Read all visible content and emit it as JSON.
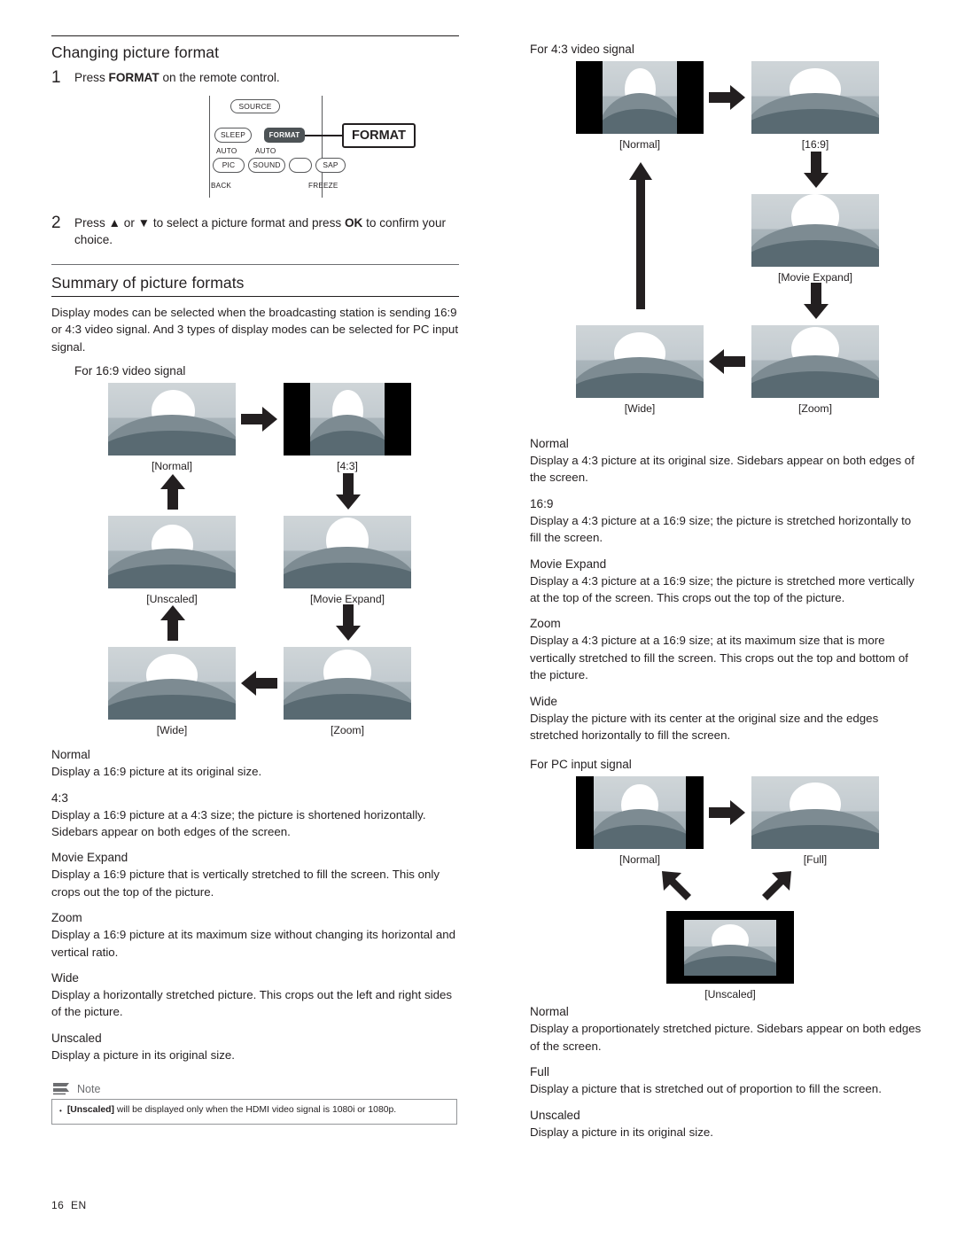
{
  "page": {
    "footer_page": "16",
    "footer_lang": "EN"
  },
  "left": {
    "heading": "Changing picture format",
    "step1": {
      "num": "1",
      "text_before": "Press ",
      "bold": "FORMAT",
      "text_after": " on the remote control."
    },
    "remote": {
      "source": "SOURCE",
      "sleep": "SLEEP",
      "format": "FORMAT",
      "auto_pic_top": "AUTO",
      "auto_pic": "PIC",
      "auto_sound_top": "AUTO",
      "auto_sound": "SOUND",
      "sap": "SAP",
      "back": "BACK",
      "freeze": "FREEZE",
      "callout": "FORMAT"
    },
    "step2": {
      "num": "2",
      "text": "Press ▲ or ▼ to select a picture format and press OK to confirm your choice.",
      "part1": "Press ",
      "part2": " or ",
      "part3": " to select a picture format and press ",
      "ok": "OK",
      "part4": " to confirm your choice."
    },
    "summary_heading": "Summary of picture formats",
    "summary_body": "Display modes can be selected when the broadcasting station is sending 16:9 or 4:3 video signal. And 3 types of display modes can be selected for PC input signal.",
    "diagram_title": "For 16:9 video signal",
    "diagram_captions": {
      "normal": "[Normal]",
      "four_three": "[4:3]",
      "unscaled": "[Unscaled]",
      "movie_expand": "[Movie Expand]",
      "wide": "[Wide]",
      "zoom": "[Zoom]"
    },
    "terms": [
      {
        "name": "Normal",
        "desc": "Display a 16:9 picture at its original size."
      },
      {
        "name": "4:3",
        "desc": "Display a 16:9 picture at a 4:3 size; the picture is shortened horizontally. Sidebars appear on both edges of the screen."
      },
      {
        "name": "Movie Expand",
        "desc": "Display a 16:9 picture that is vertically stretched to fill the screen. This only crops out the top of the picture."
      },
      {
        "name": "Zoom",
        "desc": "Display a 16:9 picture at its maximum size without changing its horizontal and vertical ratio."
      },
      {
        "name": "Wide",
        "desc": "Display a horizontally stretched picture. This crops out the left and right sides of the picture."
      },
      {
        "name": "Unscaled",
        "desc": "Display a picture in its original size."
      }
    ],
    "note": {
      "title": "Note",
      "bullet": "•",
      "text_bold": "[Unscaled]",
      "text_rest": " will be displayed only when the HDMI video signal is 1080i or 1080p."
    }
  },
  "right": {
    "diagram_title": "For 4:3 video signal",
    "diagram_captions": {
      "normal": "[Normal]",
      "sixteen_nine": "[16:9]",
      "movie_expand": "[Movie Expand]",
      "wide": "[Wide]",
      "zoom": "[Zoom]"
    },
    "terms": [
      {
        "name": "Normal",
        "desc": "Display a 4:3 picture at its original size. Sidebars appear on both edges of the screen."
      },
      {
        "name": "16:9",
        "desc": "Display a 4:3 picture at a 16:9 size; the picture is stretched horizontally to fill the screen."
      },
      {
        "name": "Movie Expand",
        "desc": "Display a 4:3 picture at a 16:9 size; the picture is stretched more vertically at the top of the screen. This crops out the top of the picture."
      },
      {
        "name": "Zoom",
        "desc": "Display a 4:3 picture at a 16:9 size; at its maximum size that is more vertically stretched to fill the screen. This crops out the top and bottom of the picture."
      },
      {
        "name": "Wide",
        "desc": "Display the picture with its center at the original size and the edges stretched horizontally to fill the screen."
      }
    ],
    "pc_title": "For PC input signal",
    "pc_captions": {
      "normal": "[Normal]",
      "full": "[Full]",
      "unscaled": "[Unscaled]"
    },
    "pc_terms": [
      {
        "name": "Normal",
        "desc": "Display a proportionately stretched picture. Sidebars appear on both edges of the screen."
      },
      {
        "name": "Full",
        "desc": "Display a picture that is stretched out of proportion to fill the screen."
      },
      {
        "name": "Unscaled",
        "desc": "Display a picture in its original size."
      }
    ]
  }
}
